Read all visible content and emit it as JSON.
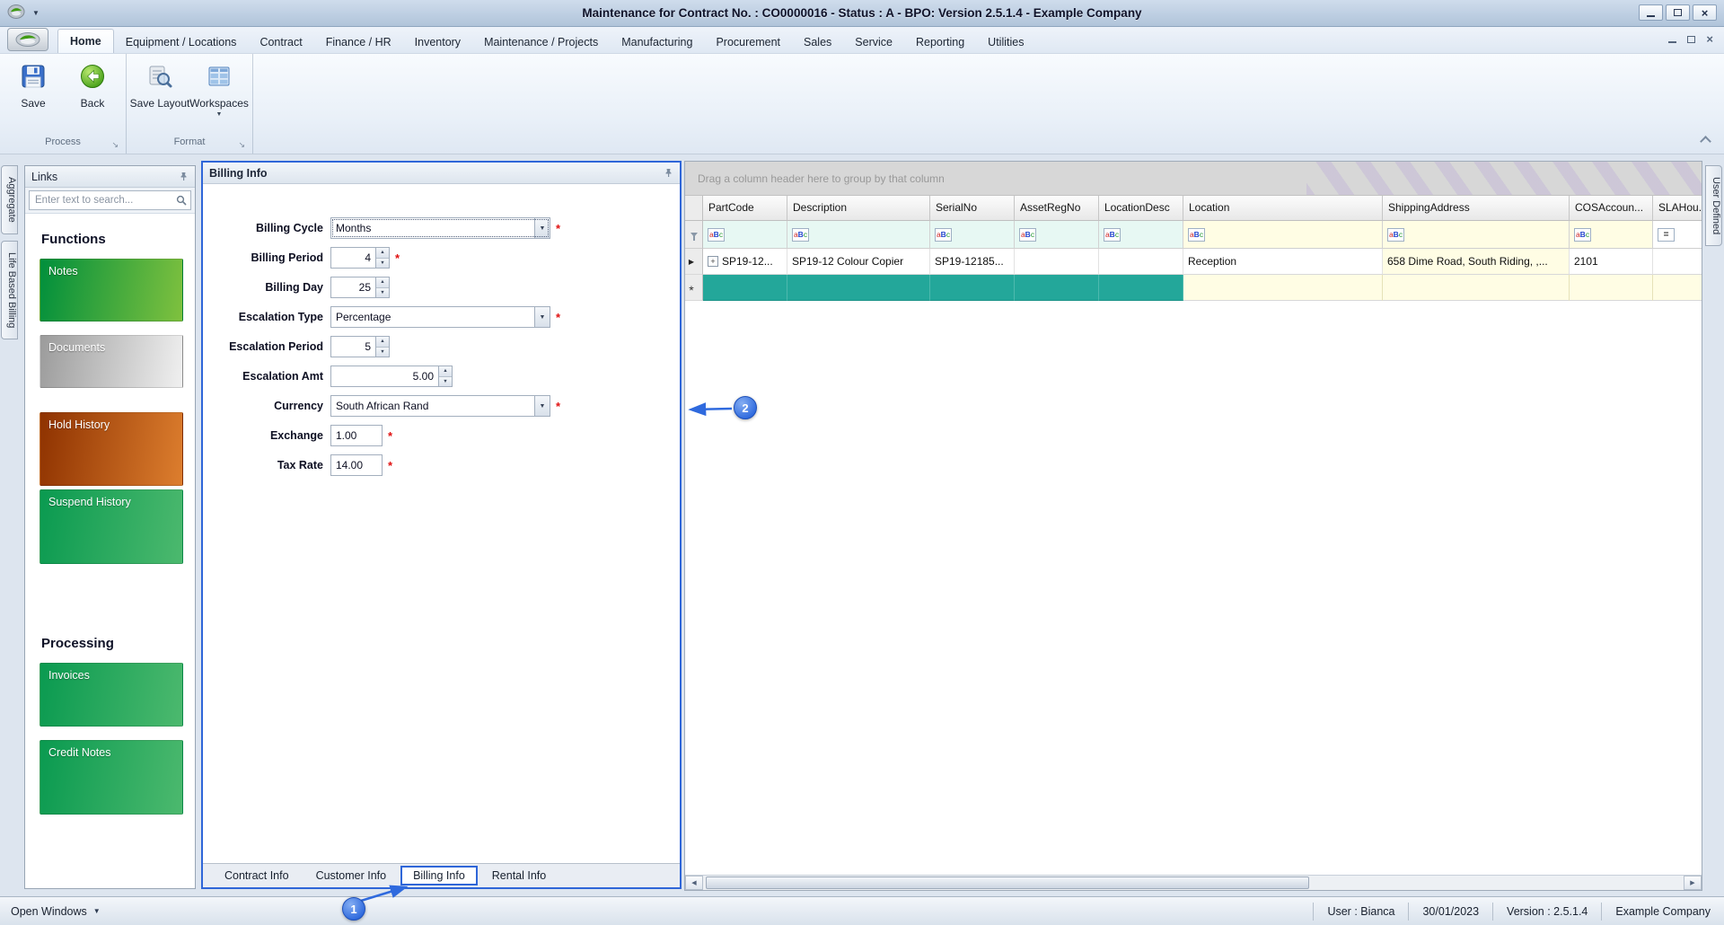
{
  "colors": {
    "accent_blue": "#2f66d8",
    "callout_blue": "#2f6ade",
    "teal_new_row": "#23a79a",
    "filter_cyan": "#e7f8f3",
    "filter_yellow": "#fffde4",
    "green_button": "#008f3c",
    "orange_button": "#8e3200",
    "silver_button": "#9b9b9b"
  },
  "window": {
    "title": "Maintenance for Contract No. : CO0000016 - Status : A - BPO: Version 2.5.1.4 - Example Company"
  },
  "ribbon": {
    "active_tab": "Home",
    "tabs": [
      "Home",
      "Equipment / Locations",
      "Contract",
      "Finance / HR",
      "Inventory",
      "Maintenance / Projects",
      "Manufacturing",
      "Procurement",
      "Sales",
      "Service",
      "Reporting",
      "Utilities"
    ],
    "groups": [
      {
        "caption": "Process",
        "buttons": [
          {
            "label": "Save",
            "icon": "save-icon"
          },
          {
            "label": "Back",
            "icon": "back-icon"
          }
        ]
      },
      {
        "caption": "Format",
        "buttons": [
          {
            "label": "Save Layout",
            "icon": "save-layout-icon"
          },
          {
            "label": "Workspaces",
            "icon": "workspaces-icon",
            "dropdown": true
          }
        ]
      }
    ]
  },
  "dock_tabs": {
    "left": [
      "Aggregate",
      "Life Based Billing"
    ],
    "right": [
      "User Defined"
    ]
  },
  "links_panel": {
    "title": "Links",
    "search_placeholder": "Enter text to search...",
    "sections": [
      {
        "heading": "Functions",
        "buttons": [
          {
            "label": "Notes",
            "style": "green"
          },
          {
            "label": "Documents",
            "style": "silver"
          },
          {
            "label": "Hold History",
            "style": "orange"
          },
          {
            "label": "Suspend History",
            "style": "green2"
          }
        ]
      },
      {
        "heading": "Processing",
        "buttons": [
          {
            "label": "Invoices",
            "style": "green2"
          },
          {
            "label": "Credit Notes",
            "style": "green2"
          }
        ]
      }
    ]
  },
  "billing_panel": {
    "title": "Billing Info",
    "fields": [
      {
        "label": "Billing Cycle",
        "value": "Months",
        "control": "dropdown",
        "required": true,
        "focused": true
      },
      {
        "label": "Billing Period",
        "value": "4",
        "control": "spin",
        "required": true
      },
      {
        "label": "Billing Day",
        "value": "25",
        "control": "spin",
        "required": false
      },
      {
        "label": "Escalation Type",
        "value": "Percentage",
        "control": "dropdown",
        "required": true
      },
      {
        "label": "Escalation Period",
        "value": "5",
        "control": "spin",
        "required": false
      },
      {
        "label": "Escalation Amt",
        "value": "5.00",
        "control": "spin_wide",
        "required": false
      },
      {
        "label": "Currency",
        "value": "South African Rand",
        "control": "dropdown",
        "required": true
      },
      {
        "label": "Exchange",
        "value": "1.00",
        "control": "text",
        "required": true
      },
      {
        "label": "Tax Rate",
        "value": "14.00",
        "control": "text",
        "required": true
      }
    ],
    "tabs": [
      "Contract Info",
      "Customer Info",
      "Billing Info",
      "Rental Info"
    ],
    "active_tab": "Billing Info"
  },
  "grid": {
    "group_hint": "Drag a column header here to group by that column",
    "columns": [
      "PartCode",
      "Description",
      "SerialNo",
      "AssetRegNo",
      "LocationDesc",
      "Location",
      "ShippingAddress",
      "COSAccoun...",
      "SLAHou..."
    ],
    "filter_icons": [
      "aBc",
      "aBc",
      "aBc",
      "aBc",
      "aBc",
      "aBc",
      "aBc",
      "aBc",
      "="
    ],
    "data_row": [
      "SP19-12...",
      "SP19-12 Colour Copier",
      "SP19-12185...",
      "",
      "",
      "Reception",
      "658 Dime Road, South Riding, ,...",
      "2101",
      ""
    ],
    "new_row_marker": "*"
  },
  "status_bar": {
    "left": "Open Windows",
    "right": [
      "User : Bianca",
      "30/01/2023",
      "Version : 2.5.1.4",
      "Example Company"
    ]
  },
  "callouts": [
    {
      "label": "1"
    },
    {
      "label": "2"
    }
  ]
}
